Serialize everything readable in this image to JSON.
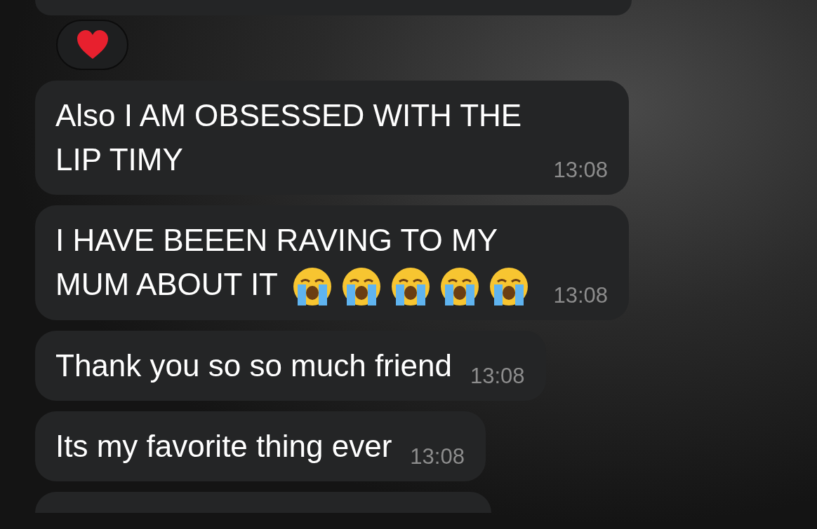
{
  "reaction": {
    "kind": "heart"
  },
  "messages": [
    {
      "text": "Also I AM OBSESSED WITH THE LIP TIMY",
      "time": "13:08"
    },
    {
      "text": "I HAVE BEEEN RAVING TO MY MUM ABOUT IT",
      "emojis": [
        {
          "kind": "crying-face"
        },
        {
          "kind": "crying-face"
        },
        {
          "kind": "crying-face"
        },
        {
          "kind": "crying-face"
        },
        {
          "kind": "crying-face"
        }
      ],
      "time": "13:08"
    },
    {
      "text": "Thank you so so much friend",
      "time": "13:08"
    },
    {
      "text": "Its my favorite thing ever",
      "time": "13:08"
    }
  ]
}
